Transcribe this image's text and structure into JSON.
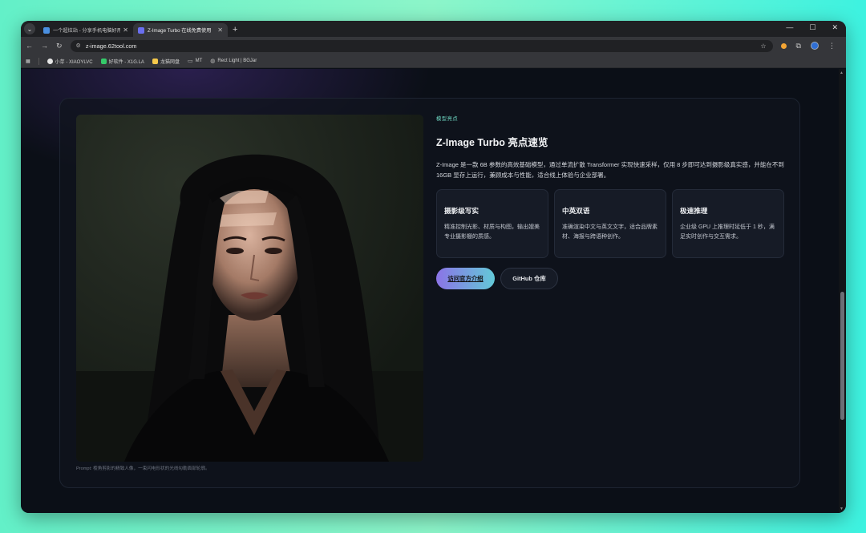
{
  "browser": {
    "tabs": [
      {
        "title": "一个超炫站 - 分享手机电脑好用的",
        "favicon_color": "#4a8fe0",
        "active": false
      },
      {
        "title": "Z-Image Turbo 在线免费使用",
        "favicon_color": "#6a6ff0",
        "active": true
      }
    ],
    "url": "z-image.62tool.com",
    "bookmarks": [
      {
        "label": "小芽 - XIAOYLVC",
        "color": "#e6e6e6"
      },
      {
        "label": "好软件 - X1G.LA",
        "color": "#35c96a"
      },
      {
        "label": "龙猫网盘",
        "color": "#f5c84b"
      },
      {
        "label": "MT",
        "color": "#9aa0a6"
      },
      {
        "label": "Rect Light | BGJar",
        "color": "#9aa0a6"
      }
    ]
  },
  "page": {
    "eyebrow": "模型亮点",
    "title": "Z-Image Turbo 亮点速览",
    "description": "Z-Image 是一款 6B 参数的高效基础模型，通过单流扩散 Transformer 实现快速采样，仅用 8 步即可达到摄影级真实感，并能在不到 16GB 显存上运行，兼顾成本与性能，适合线上体验与企业部署。",
    "features": [
      {
        "title": "摄影级写实",
        "desc": "精准控制光影、材质与构图，输出媲美专业摄影棚的质感。"
      },
      {
        "title": "中英双语",
        "desc": "准确渲染中文与英文文字，适合品牌素材、海报与跨语种创作。"
      },
      {
        "title": "极速推理",
        "desc": "企业级 GPU 上推理时延低于 1 秒，满足实时创作与交互需求。"
      }
    ],
    "primary_button": "访问官方介绍",
    "secondary_button": "GitHub 仓库",
    "photo_caption": "Prompt: 棱角剪影的精致人像，一束闪电形状的光线勾勒面部轮廓。"
  },
  "colors": {
    "accent_teal": "#6fd9c3",
    "gradient_start": "#8b73e6",
    "gradient_end": "#63c9d8"
  }
}
